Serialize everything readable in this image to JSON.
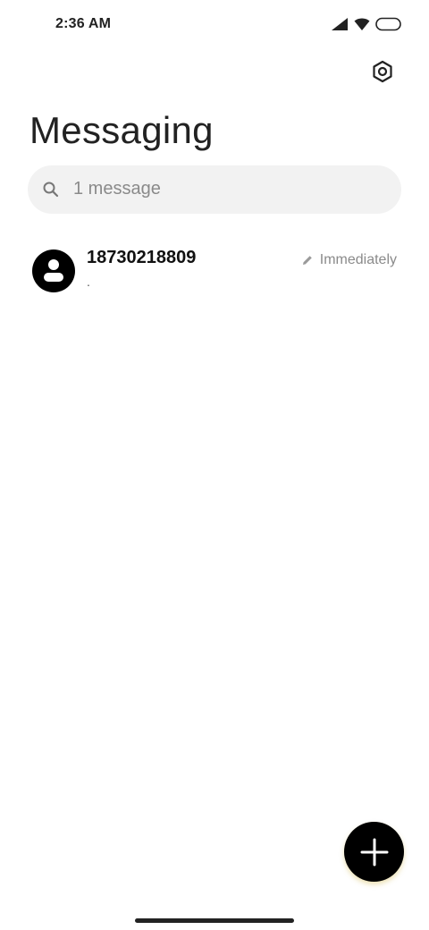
{
  "status_bar": {
    "time": "2:36 AM",
    "icons": [
      "cellular-signal-icon",
      "wifi-icon",
      "battery-icon"
    ]
  },
  "header": {
    "settings_icon": "settings-gear-icon",
    "title": "Messaging"
  },
  "search": {
    "icon": "search-icon",
    "placeholder": "1 message"
  },
  "conversations": [
    {
      "name": "18730218809",
      "preview": ".",
      "status_icon": "draft-pencil-icon",
      "time": "Immediately"
    }
  ],
  "fab": {
    "icon": "plus-icon"
  },
  "colors": {
    "background": "#ffffff",
    "search_background": "#f2f2f2",
    "fab_background": "#000000",
    "secondary_text": "#8a8a8a"
  }
}
